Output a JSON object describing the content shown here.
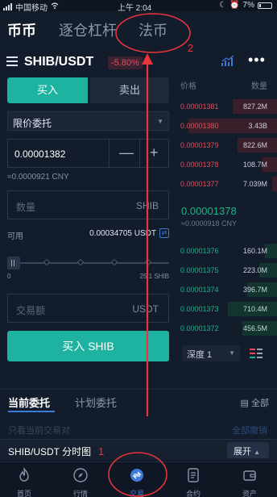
{
  "status_bar": {
    "carrier": "中国移动",
    "time": "上午 2:04",
    "battery": "7%"
  },
  "top_nav": {
    "tabs": [
      {
        "label": "币币",
        "active": true
      },
      {
        "label": "逐仓杠杆",
        "active": false
      },
      {
        "label": "法币",
        "active": false
      }
    ]
  },
  "pair": {
    "name": "SHIB/USDT",
    "change": "-5.80%"
  },
  "trade": {
    "buy_tab": "买入",
    "sell_tab": "卖出",
    "order_type": "限价委托",
    "price": "0.00001382",
    "price_cny": "≈0.0000921 CNY",
    "amount_placeholder": "数量",
    "amount_unit": "SHIB",
    "available_label": "可用",
    "available_value": "0.00034705 USDT",
    "slider_min": "0",
    "slider_max": "25.1 SHIB",
    "total_placeholder": "交易额",
    "total_unit": "USDT",
    "submit": "买入 SHIB"
  },
  "orderbook": {
    "header_price": "价格",
    "header_qty": "数量",
    "asks": [
      {
        "price": "0.00001381",
        "qty": "827.2M",
        "depth": 0.45
      },
      {
        "price": "0.00001380",
        "qty": "3.43B",
        "depth": 0.9
      },
      {
        "price": "0.00001379",
        "qty": "822.6M",
        "depth": 0.4
      },
      {
        "price": "0.00001378",
        "qty": "108.7M",
        "depth": 0.15
      },
      {
        "price": "0.00001377",
        "qty": "7.039M",
        "depth": 0.05
      }
    ],
    "last_price": "0.00001378",
    "last_cny": "≈0.0000918 CNY",
    "bids": [
      {
        "price": "0.00001376",
        "qty": "160.1M",
        "depth": 0.12
      },
      {
        "price": "0.00001375",
        "qty": "223.0M",
        "depth": 0.18
      },
      {
        "price": "0.00001374",
        "qty": "396.7M",
        "depth": 0.3
      },
      {
        "price": "0.00001373",
        "qty": "710.4M",
        "depth": 0.5
      },
      {
        "price": "0.00001372",
        "qty": "456.5M",
        "depth": 0.35
      }
    ],
    "depth_label": "深度 1"
  },
  "orders": {
    "tab_current": "当前委托",
    "tab_plan": "计划委托",
    "all": "全部",
    "hint_left": "只看当前交易对",
    "hint_right": "全部撤销"
  },
  "chart_bar": {
    "title": "SHIB/USDT 分时图",
    "expand": "展开"
  },
  "bottom_nav": [
    {
      "label": "首页",
      "icon": "flame-icon"
    },
    {
      "label": "行情",
      "icon": "compass-icon"
    },
    {
      "label": "交易",
      "icon": "trade-icon",
      "active": true
    },
    {
      "label": "合约",
      "icon": "contract-icon"
    },
    {
      "label": "资产",
      "icon": "wallet-icon"
    }
  ],
  "annotations": {
    "step1": "1",
    "step2": "2"
  },
  "colors": {
    "buy": "#1db3a0",
    "sell": "#e04f5f",
    "accent": "#3c7bd9",
    "annotation": "#e8343c"
  }
}
